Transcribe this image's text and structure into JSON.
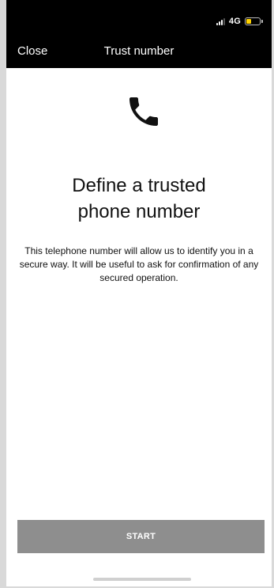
{
  "status_bar": {
    "network": "4G",
    "signal_bars_active": 3,
    "battery_level": 0.35,
    "battery_color": "#ffd200"
  },
  "nav": {
    "close_label": "Close",
    "title": "Trust number"
  },
  "main": {
    "icon": "phone-handset-icon",
    "headline_line1": "Define a trusted",
    "headline_line2": "phone number",
    "description": "This telephone number will allow us to identify you in a secure way. It will be useful to ask for confirmation of any secured operation.",
    "start_label": "START",
    "start_button_color": "#8e8e8e"
  }
}
